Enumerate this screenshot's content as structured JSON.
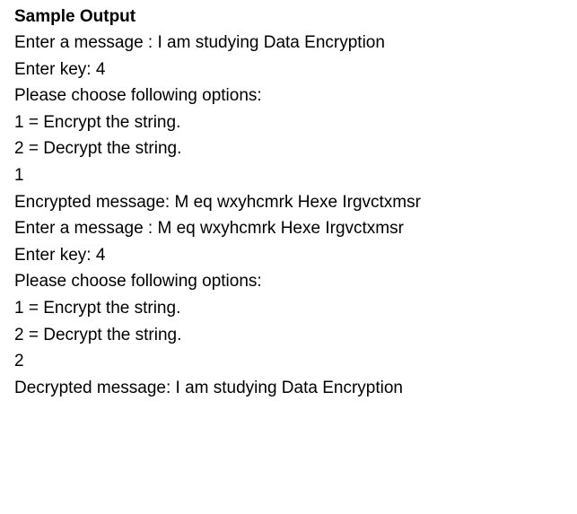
{
  "document": {
    "heading": "Sample Output",
    "lines": [
      "Enter a message : I am studying Data Encryption",
      "Enter key: 4",
      "Please choose following options:",
      "1 = Encrypt the string.",
      "2 = Decrypt the string.",
      "1",
      "Encrypted message: M eq wxyhcmrk Hexe Irgvctxmsr",
      "Enter a message : M eq wxyhcmrk Hexe Irgvctxmsr",
      "Enter key: 4",
      "Please choose following options:",
      "1 = Encrypt the string.",
      "2 = Decrypt the string.",
      "2",
      "Decrypted message: I am studying Data Encryption"
    ]
  }
}
